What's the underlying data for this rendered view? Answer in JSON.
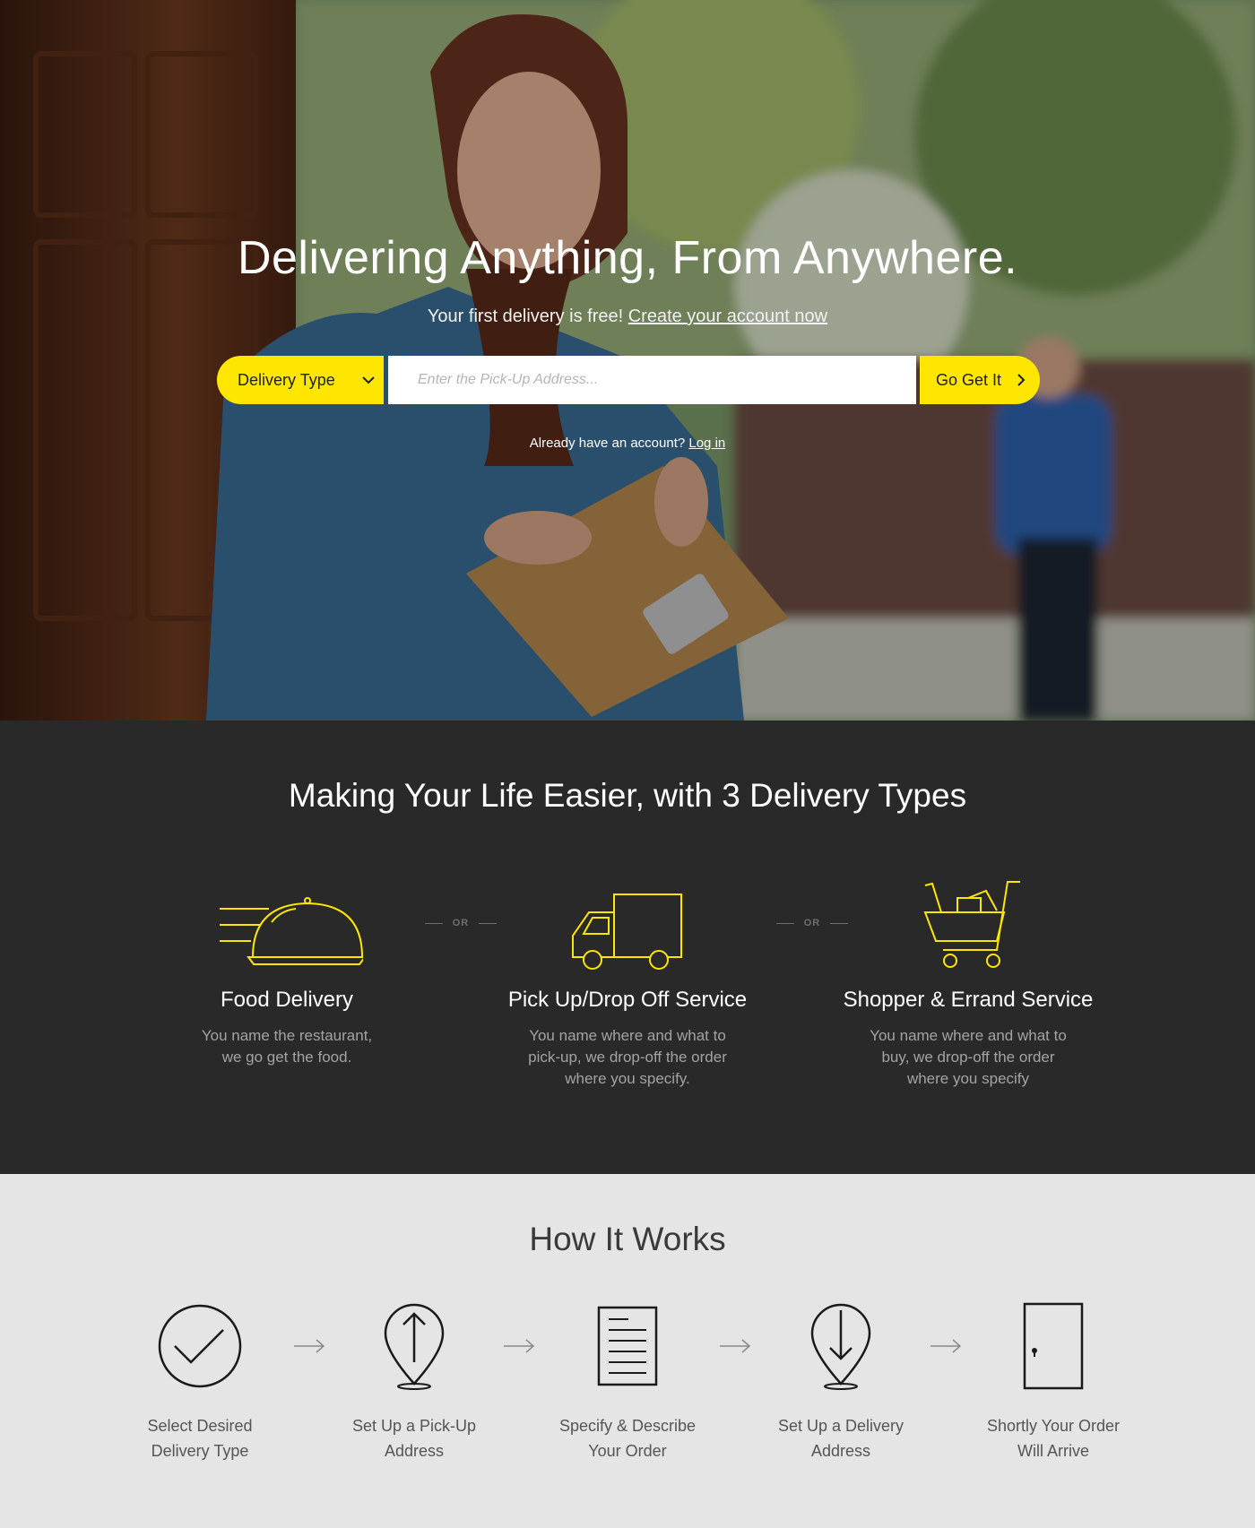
{
  "hero": {
    "title": "Delivering Anything, From Anywhere.",
    "subtitle_prefix": "Your first delivery is free!",
    "subtitle_link": "Create your account now",
    "delivery_type_label": "Delivery Type",
    "address_placeholder": "Enter the Pick-Up Address...",
    "go_label": "Go Get It",
    "login_prefix": "Already have an account?",
    "login_link": "Log in"
  },
  "types": {
    "title": "Making Your Life Easier, with 3 Delivery Types",
    "or_label": "OR",
    "items": [
      {
        "name": "Food Delivery",
        "desc_line1": "You name the restaurant,",
        "desc_line2": "we go get the food.",
        "desc_line3": "",
        "icon": "food-cloche-icon"
      },
      {
        "name": "Pick Up/Drop Off Service",
        "desc_line1": "You name where and what to",
        "desc_line2": "pick-up, we drop-off the order",
        "desc_line3": "where you specify.",
        "icon": "delivery-truck-icon"
      },
      {
        "name": "Shopper & Errand Service",
        "desc_line1": "You name where and what to",
        "desc_line2": "buy, we drop-off the order",
        "desc_line3": "where you specify",
        "icon": "shopping-cart-icon"
      }
    ]
  },
  "how": {
    "title": "How It Works",
    "steps": [
      {
        "line1": "Select Desired",
        "line2": "Delivery Type",
        "icon": "checkmark-circle-icon"
      },
      {
        "line1": "Set Up a Pick-Up",
        "line2": "Address",
        "icon": "pin-up-arrow-icon"
      },
      {
        "line1": "Specify & Describe",
        "line2": "Your Order",
        "icon": "document-icon"
      },
      {
        "line1": "Set Up a Delivery",
        "line2": "Address",
        "icon": "pin-down-arrow-icon"
      },
      {
        "line1": "Shortly Your Order",
        "line2": "Will Arrive",
        "icon": "door-icon"
      }
    ]
  },
  "colors": {
    "accent": "#ffe600",
    "dark_bg": "#2a2929",
    "light_bg": "#e5e5e5"
  }
}
